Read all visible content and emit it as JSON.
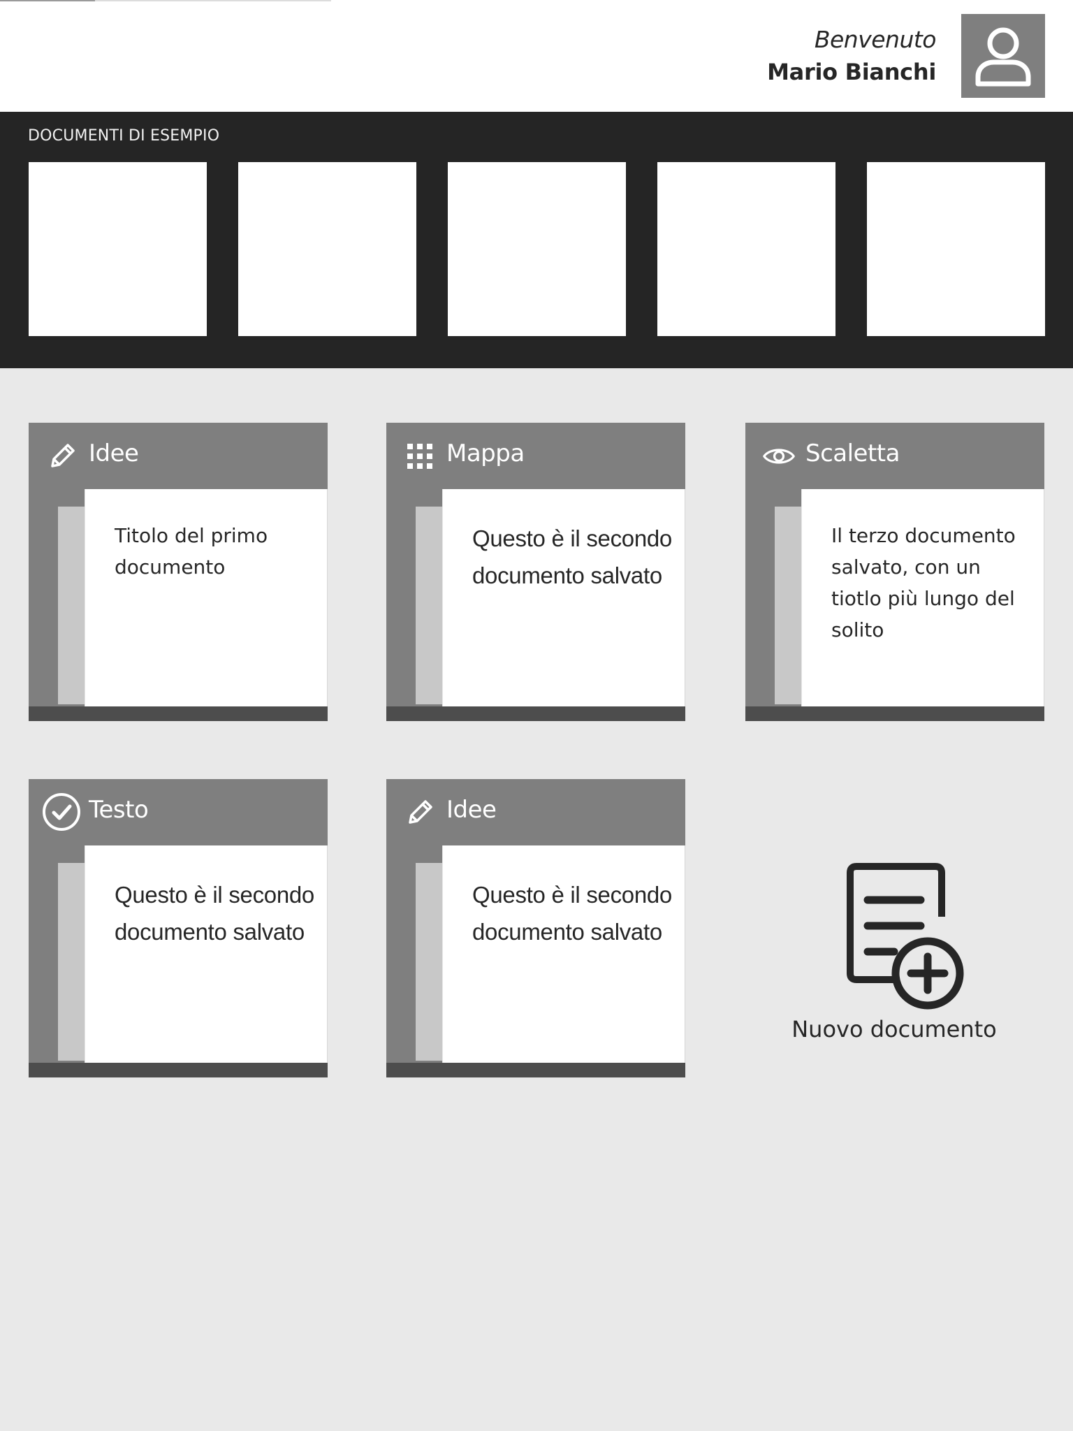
{
  "header": {
    "greeting": "Benvenuto",
    "user_name": "Mario Bianchi",
    "avatar_icon": "user-icon"
  },
  "examples": {
    "title": "DOCUMENTI DI ESEMPIO",
    "count": 5
  },
  "documents": [
    {
      "category": "Idee",
      "icon": "pencil-icon",
      "text": "Titolo del primo documento"
    },
    {
      "category": "Mappa",
      "icon": "grid-icon",
      "text": "Questo è il secondo documento salvato"
    },
    {
      "category": "Scaletta",
      "icon": "eye-icon",
      "text": "Il terzo documento salvato, con un tiotlo più lungo del solito"
    },
    {
      "category": "Testo",
      "icon": "check-circle-icon",
      "text": "Questo è il secondo documento salvato"
    },
    {
      "category": "Idee",
      "icon": "pencil-icon",
      "text": "Questo è il secondo documento salvato"
    }
  ],
  "new_document": {
    "label": "Nuovo documento",
    "icon": "document-add-icon"
  },
  "colors": {
    "page_background": "#e9e9e9",
    "band_background": "#252525",
    "card_header": "#7f7f7f",
    "card_footer": "#4d4d4d",
    "text": "#262626"
  }
}
